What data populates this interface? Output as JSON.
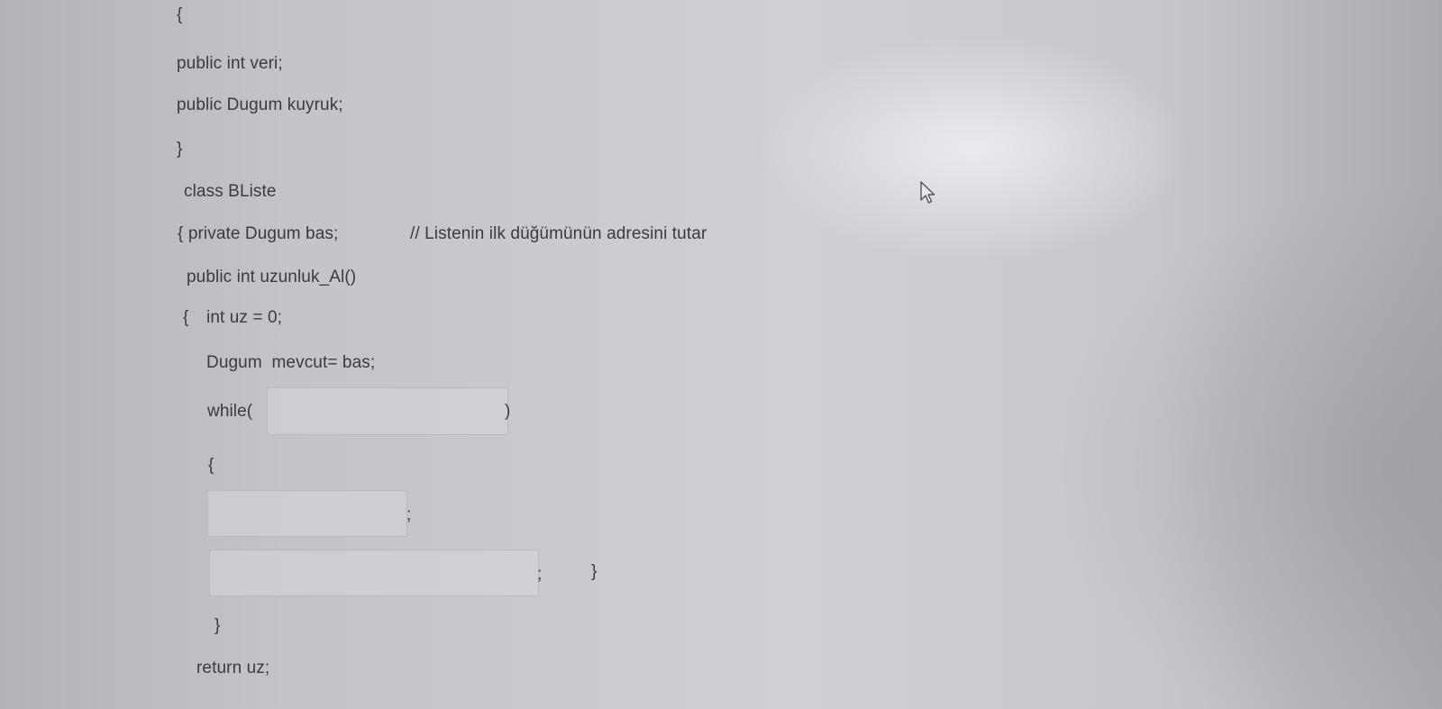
{
  "code": {
    "open_brace": "{",
    "field_veri": "public int veri;",
    "field_kuyruk": "public Dugum kuyruk;",
    "close_brace": "}",
    "class_decl": "class BListe",
    "private_decl": "{ private Dugum bas;",
    "comment": "// Listenin ilk düğümünün adresini tutar",
    "method_sig": "public int uzunluk_Al()",
    "method_open": "{",
    "uz_decl": "int uz = 0;",
    "mevcut_decl": "Dugum  mevcut= bas;",
    "while_start": "while(",
    "while_end": ")",
    "loop_open": "{",
    "semicolon1": ";",
    "semicolon2": ";",
    "loop_close": "}",
    "while_close": "}",
    "return_stmt": "return uz;"
  },
  "blanks": {
    "while_condition": "",
    "statement_1": "",
    "statement_2": ""
  },
  "icons": {
    "cursor": "mouse-pointer-icon"
  }
}
